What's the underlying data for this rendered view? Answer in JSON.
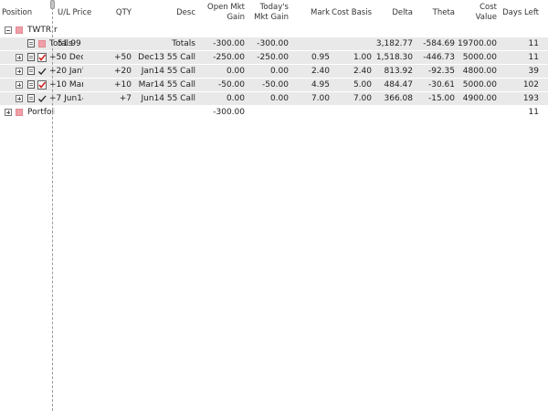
{
  "headers": {
    "position": "Position",
    "ul_price": "U/L Price",
    "qty": "QTY",
    "desc": "Desc",
    "open_mkt_gain": "Open Mkt\nGain",
    "todays_mkt_gain": "Today's\nMkt Gain",
    "mark": "Mark",
    "cost_basis": "Cost Basis",
    "delta": "Delta",
    "theta": "Theta",
    "cost_value": "Cost Value",
    "days_left": "Days Left"
  },
  "group": {
    "name": "TWTR r",
    "marker_color": "#f0a0a8"
  },
  "totals_row": {
    "label": "Totals",
    "ul_price": "51.99",
    "qty": "",
    "desc": "Totals",
    "open_gain": "-300.00",
    "today_gain": "-300.00",
    "mark": "",
    "cost_basis": "",
    "delta": "3,182.77",
    "theta": "-584.69",
    "cost_value": "19700.00",
    "days_left": "11"
  },
  "positions": [
    {
      "name": "+50 Dec'",
      "qty": "+50",
      "desc": "Dec13 55 Call",
      "open_gain": "-250.00",
      "today_gain": "-250.00",
      "mark": "0.95",
      "cost_basis": "1.00",
      "delta": "1,518.30",
      "theta": "-446.73",
      "cost_value": "5000.00",
      "days_left": "11",
      "check_icon": "red-check-icon"
    },
    {
      "name": "+20 Jan'",
      "qty": "+20",
      "desc": "Jan14 55 Call",
      "open_gain": "0.00",
      "today_gain": "0.00",
      "mark": "2.40",
      "cost_basis": "2.40",
      "delta": "813.92",
      "theta": "-92.35",
      "cost_value": "4800.00",
      "days_left": "39",
      "check_icon": "black-check-icon"
    },
    {
      "name": "+10 Mar1",
      "qty": "+10",
      "desc": "Mar14 55 Call",
      "open_gain": "-50.00",
      "today_gain": "-50.00",
      "mark": "4.95",
      "cost_basis": "5.00",
      "delta": "484.47",
      "theta": "-30.61",
      "cost_value": "5000.00",
      "days_left": "102",
      "check_icon": "red-check-icon"
    },
    {
      "name": "+7 Jun14",
      "qty": "+7",
      "desc": "Jun14 55 Call",
      "open_gain": "0.00",
      "today_gain": "0.00",
      "mark": "7.00",
      "cost_basis": "7.00",
      "delta": "366.08",
      "theta": "-15.00",
      "cost_value": "4900.00",
      "days_left": "193",
      "check_icon": "black-check-icon"
    }
  ],
  "portfolio_row": {
    "name": "Portfoli",
    "open_gain": "-300.00",
    "days_left": "11"
  },
  "colors": {
    "row_shade": "#e9e9e9",
    "marker": "#f0a0a8",
    "check_red": "#d02020"
  }
}
